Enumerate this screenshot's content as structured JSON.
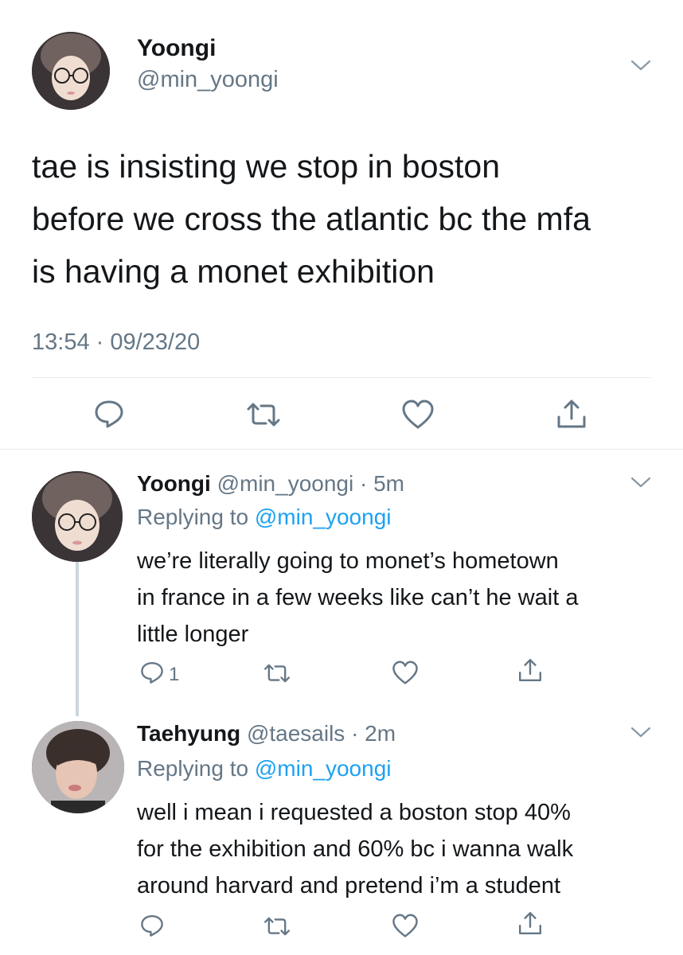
{
  "main_tweet": {
    "display_name": "Yoongi",
    "handle": "@min_yoongi",
    "text_lines": [
      "tae is insisting we stop in boston",
      "before we cross the atlantic bc the mfa",
      "is having a monet exhibition"
    ],
    "timestamp": "13:54 · 09/23/20"
  },
  "replies": [
    {
      "display_name": "Yoongi",
      "handle_time": "@min_yoongi · 5m",
      "replying_prefix": "Replying to",
      "replying_to": "@min_yoongi",
      "text_lines": [
        "we’re literally going to monet’s hometown",
        "in france in a few weeks like can’t he wait a",
        "little longer"
      ],
      "reply_count": "1"
    },
    {
      "display_name": "Taehyung",
      "handle_time": "@taesails · 2m",
      "replying_prefix": "Replying to",
      "replying_to": "@min_yoongi",
      "text_lines": [
        "well i mean i requested a boston stop 40%",
        "for the exhibition and 60% bc i wanna walk",
        "around harvard and pretend i’m a student"
      ],
      "reply_count": ""
    }
  ],
  "colors": {
    "text": "#14171a",
    "muted": "#657786",
    "link": "#1da1f2",
    "divider": "#e6ecf0"
  },
  "icons": [
    "reply-icon",
    "retweet-icon",
    "like-icon",
    "share-icon",
    "chevron-down-icon"
  ]
}
